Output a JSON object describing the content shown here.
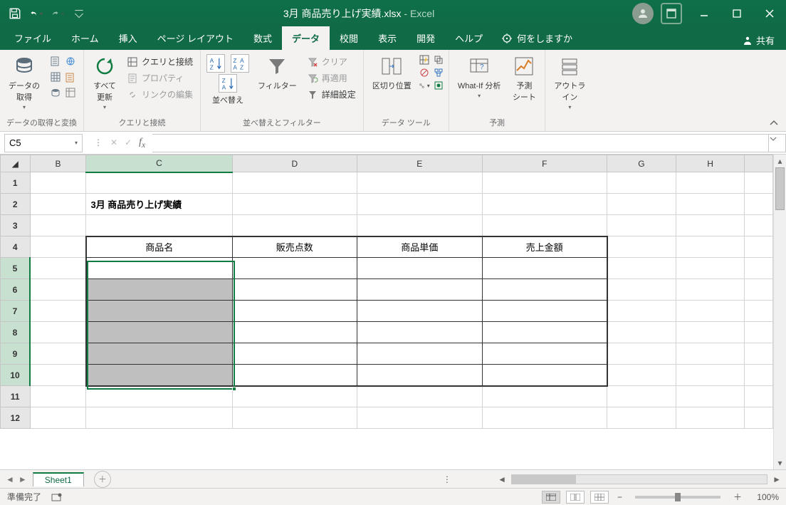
{
  "title": {
    "file": "3月 商品売り上げ実績.xlsx",
    "app": "Excel",
    "sep": " - "
  },
  "qat": {
    "save": "保存",
    "undo": "元に戻す",
    "redo": "やり直し"
  },
  "tabs": {
    "file": "ファイル",
    "home": "ホーム",
    "insert": "挿入",
    "page": "ページ レイアウト",
    "formula": "数式",
    "data": "データ",
    "review": "校閲",
    "view": "表示",
    "developer": "開発",
    "help": "ヘルプ",
    "tell": "何をしますか",
    "share": "共有"
  },
  "ribbon": {
    "g1": {
      "big": "データの\n取得",
      "label": "データの取得と変換"
    },
    "g2": {
      "big": "すべて\n更新",
      "b1": "クエリと接続",
      "b2": "プロパティ",
      "b3": "リンクの編集",
      "label": "クエリと接続"
    },
    "g3": {
      "big": "並べ替え",
      "big2": "フィルター",
      "b1": "クリア",
      "b2": "再適用",
      "b3": "詳細設定",
      "label": "並べ替えとフィルター"
    },
    "g4": {
      "big": "区切り位置",
      "label": "データ ツール"
    },
    "g5": {
      "big1": "What-If 分析",
      "big2": "予測\nシート",
      "label": "予測"
    },
    "g6": {
      "big": "アウトラ\nイン",
      "label": ""
    }
  },
  "formula": {
    "name": "C5",
    "value": ""
  },
  "columns": [
    "B",
    "C",
    "D",
    "E",
    "F",
    "G",
    "H"
  ],
  "rows": [
    "1",
    "2",
    "3",
    "4",
    "5",
    "6",
    "7",
    "8",
    "9",
    "10",
    "11",
    "12"
  ],
  "cells": {
    "title": "3月 商品売り上げ実績",
    "h1": "商品名",
    "h2": "販売点数",
    "h3": "商品単価",
    "h4": "売上金額"
  },
  "sheet": {
    "name": "Sheet1"
  },
  "status": {
    "ready": "準備完了",
    "zoom": "100%"
  }
}
